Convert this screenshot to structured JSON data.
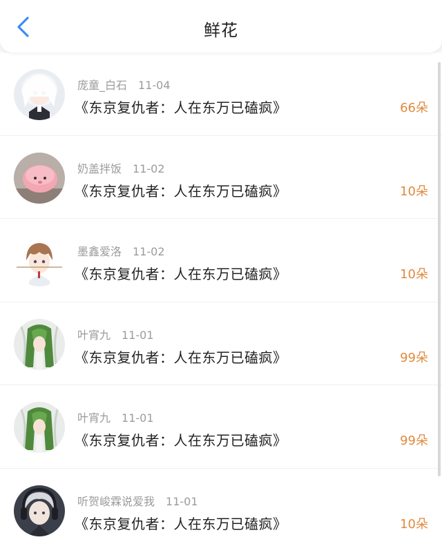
{
  "header": {
    "title": "鲜花",
    "back_icon": "chevron-left-icon",
    "accent_color": "#3a8df5"
  },
  "flower_color": "#e08a3c",
  "records": [
    {
      "user": "庞童_白石",
      "date": "11-04",
      "book": "《东京复仇者：人在东万已磕疯》",
      "count": "66朵",
      "avatar": "anime-girl-white-hair"
    },
    {
      "user": "奶盖拌饭",
      "date": "11-02",
      "book": "《东京复仇者：人在东万已磕疯》",
      "count": "10朵",
      "avatar": "pink-fluffy-creature"
    },
    {
      "user": "墨鑫爱洛",
      "date": "11-02",
      "book": "《东京复仇者：人在东万已磕疯》",
      "count": "10朵",
      "avatar": "anime-boy-brown-hair"
    },
    {
      "user": "叶宵九",
      "date": "11-01",
      "book": "《东京复仇者：人在东万已磕疯》",
      "count": "99朵",
      "avatar": "green-hair-character"
    },
    {
      "user": "叶宵九",
      "date": "11-01",
      "book": "《东京复仇者：人在东万已磕疯》",
      "count": "99朵",
      "avatar": "green-hair-character"
    },
    {
      "user": "听贺峻霖说爱我",
      "date": "11-01",
      "book": "《东京复仇者：人在东万已磕疯》",
      "count": "10朵",
      "avatar": "anime-boy-headphones"
    }
  ]
}
